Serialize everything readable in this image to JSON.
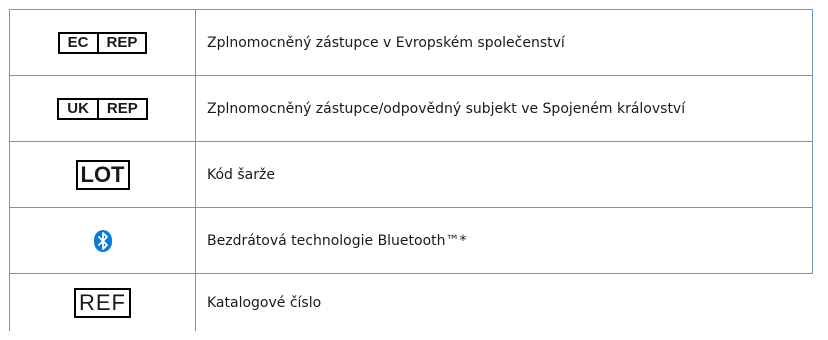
{
  "rows": [
    {
      "symbol": [
        "EC",
        "REP"
      ],
      "description": "Zplnomocněný zástupce v Evropském společenství"
    },
    {
      "symbol": [
        "UK",
        "REP"
      ],
      "description": "Zplnomocněný zástupce/odpovědný subjekt ve Spojeném království"
    },
    {
      "symbol": "LOT",
      "description": "Kód šarže"
    },
    {
      "symbol_icon": "bluetooth-icon",
      "description": "Bezdrátová technologie Bluetooth™*"
    },
    {
      "symbol": "REF",
      "description": "Katalogové číslo"
    }
  ],
  "colors": {
    "border": "#6a9ac4",
    "bluetooth": "#0a7cd6"
  }
}
